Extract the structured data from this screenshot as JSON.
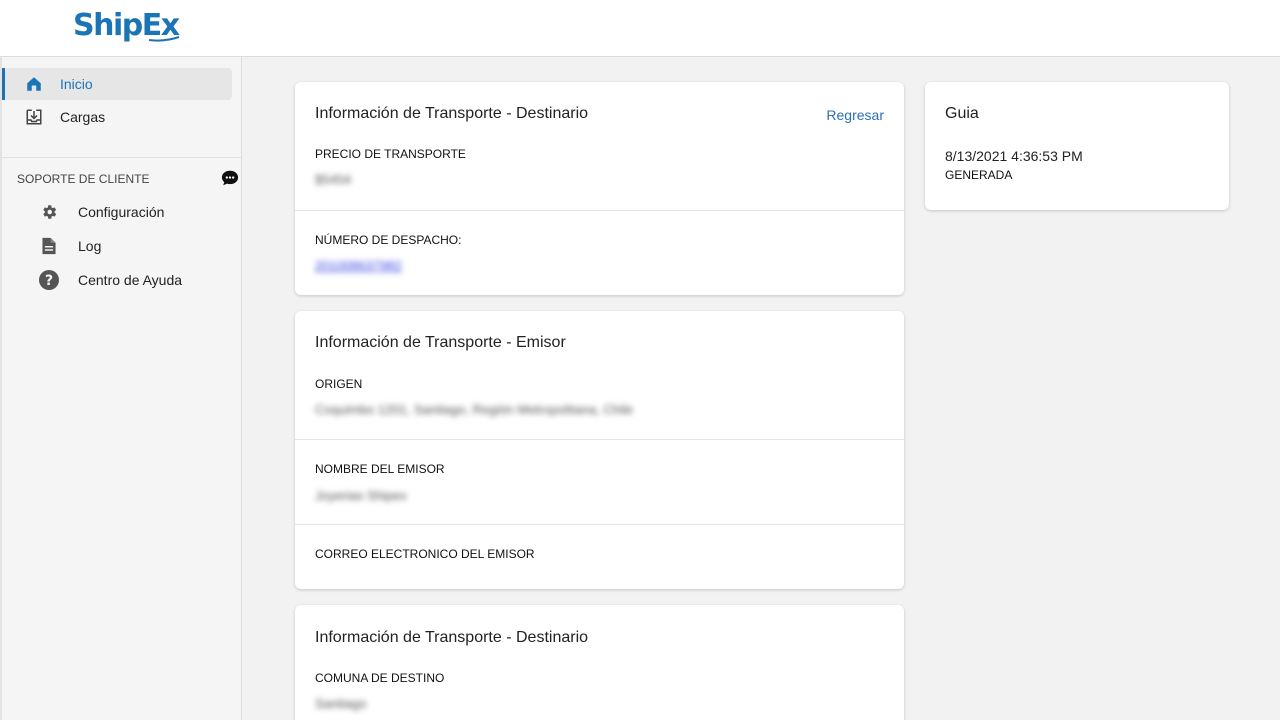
{
  "brand": {
    "name": "ShipEx",
    "color": "#1b74b6"
  },
  "sidebar": {
    "items": [
      {
        "label": "Inicio",
        "icon": "home-icon",
        "active": true
      },
      {
        "label": "Cargas",
        "icon": "download-tray-icon",
        "active": false
      }
    ],
    "support": {
      "title": "SOPORTE DE CLIENTE",
      "chat_icon": "chat-bubble-icon",
      "items": [
        {
          "label": "Configuración",
          "icon": "gear-icon"
        },
        {
          "label": "Log",
          "icon": "document-icon"
        },
        {
          "label": "Centro de Ayuda",
          "icon": "help-circle-icon"
        }
      ]
    }
  },
  "cards": {
    "destino_top": {
      "title": "Información de Transporte - Destinario",
      "back_link": "Regresar",
      "price_label": "PRECIO DE TRANSPORTE",
      "price_value": "$5454",
      "dispatch_label": "NÚMERO DE DESPACHO:",
      "dispatch_value": "201008637982"
    },
    "emisor": {
      "title": "Información de Transporte - Emisor",
      "origin_label": "ORIGEN",
      "origin_value": "Coquimbo 1201, Santiago, Región Metropolitana, Chile",
      "sender_name_label": "NOMBRE DEL EMISOR",
      "sender_name_value": "Joyerias Shipex",
      "sender_email_label": "CORREO ELECTRONICO DEL EMISOR"
    },
    "destino_bottom": {
      "title": "Información de Transporte - Destinario",
      "commune_label": "COMUNA DE DESTINO",
      "commune_value": "Santiago"
    },
    "guia": {
      "title": "Guia",
      "datetime": "8/13/2021 4:36:53 PM",
      "status": "GENERADA"
    }
  }
}
